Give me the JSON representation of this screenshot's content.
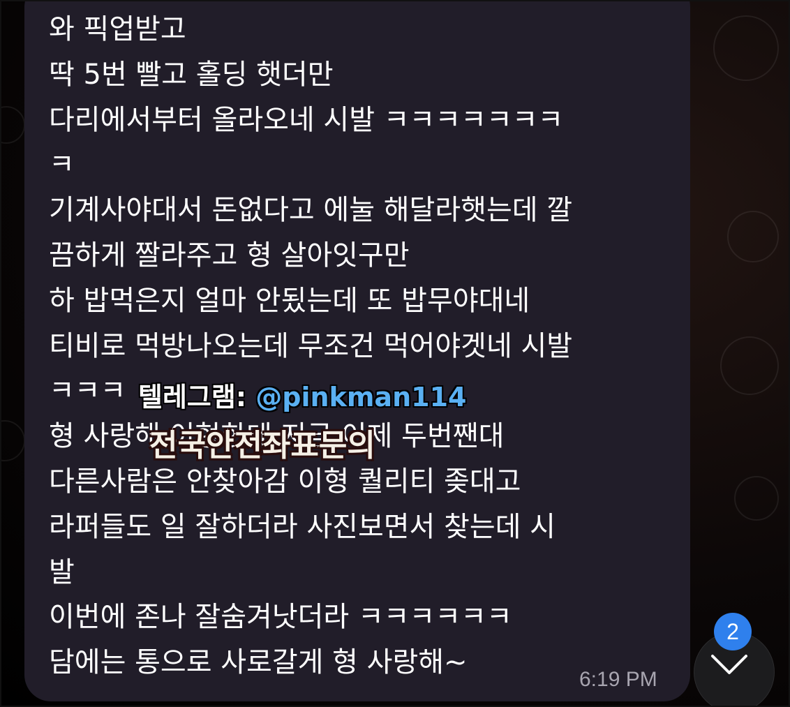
{
  "message": {
    "lines": [
      "와 픽업받고",
      "딱 5번 빨고 홀딩 햇더만",
      "다리에서부터 올라오네 시발 ㅋㅋㅋㅋㅋㅋㅋ",
      "ㅋ",
      "기계사야대서 돈없다고 에눌 해달라햇는데 깔",
      "끔하게 짤라주고 형 살아잇구만",
      "하 밥먹은지 얼마 안됬는데 또 밥무야대네",
      "티비로 먹방나오는데 무조건 먹어야겟네 시발",
      "ㅋㅋㅋ",
      "형 사랑해 이형한테 지금 이제 두번짼대",
      "다른사람은 안찾아감 이형 퀄리티 좆대고",
      "라퍼들도 일 잘하더라 사진보면서 찾는데 시",
      "발",
      "이번에 존나 잘숨겨낫더라 ㅋㅋㅋㅋㅋㅋ",
      "담에는 통으로 사로갈게 형 사랑해~"
    ],
    "time": "6:19 PM"
  },
  "watermark": {
    "label": "텔레그램:",
    "handle": "@pinkman114",
    "caption": "전국안전좌표문의"
  },
  "scroll_button": {
    "badge_count": "2",
    "icon": "chevron-down-icon"
  },
  "colors": {
    "bubble": "#211d29",
    "badge": "#2f80ed",
    "handle": "#5ab0f2"
  }
}
